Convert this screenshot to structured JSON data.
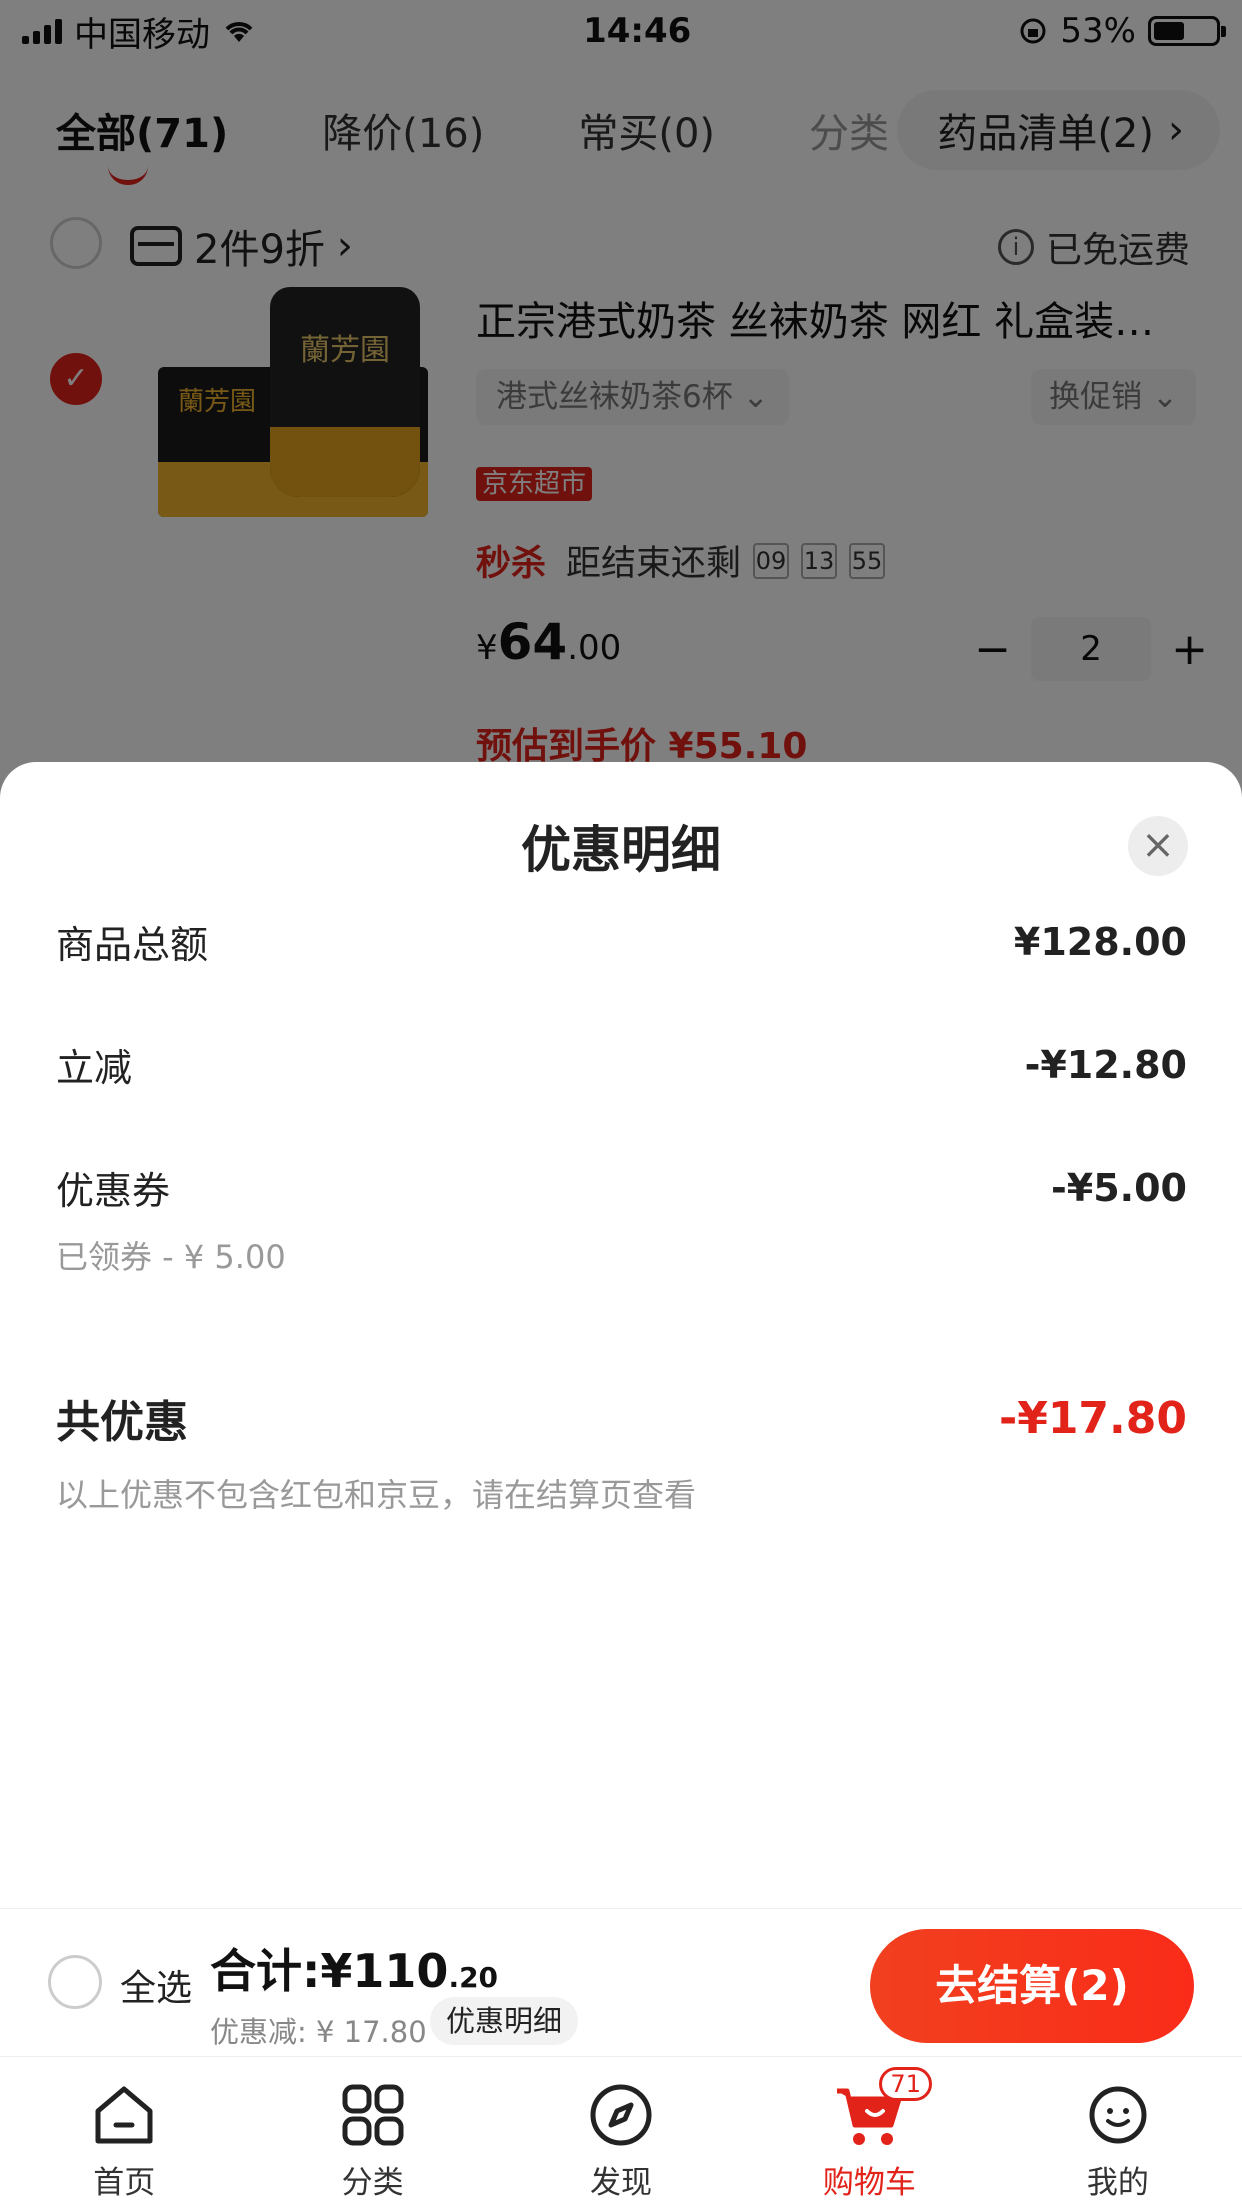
{
  "status_bar": {
    "carrier": "中国移动",
    "time": "14:46",
    "battery": "53%"
  },
  "tabs": {
    "items": [
      {
        "label": "全部(71)"
      },
      {
        "label": "降价(16)"
      },
      {
        "label": "常买(0)"
      },
      {
        "label": "分类"
      }
    ],
    "pill_label": "药品清单(2)",
    "pill_chevron": "›"
  },
  "cart_item": {
    "promo": "2件9折",
    "promo_chevron": "›",
    "shipping": "已免运费",
    "product_title": "正宗港式奶茶 丝袜奶茶 网红 礼盒装…",
    "brand_on_pack": "蘭芳園",
    "spec": "港式丝袜奶茶6杯",
    "switch_promo": "换促销",
    "store_tag": "京东超市",
    "flash_label": "秒杀",
    "flash_text": "距结束还剩",
    "countdown": [
      "09",
      "13",
      "55"
    ],
    "price_symbol": "¥",
    "price_int": "64",
    "price_dec": ".00",
    "qty_minus": "−",
    "quantity": "2",
    "qty_plus": "+",
    "estimated": "预估到手价 ¥55.10"
  },
  "sheet": {
    "title": "优惠明细",
    "close_glyph": "×",
    "rows": [
      {
        "label": "商品总额",
        "amount": "¥128.00"
      },
      {
        "label": "立减",
        "amount": "-¥12.80"
      },
      {
        "label": "优惠券",
        "amount": "-¥5.00",
        "sub": "已领券 - ¥ 5.00"
      }
    ],
    "total": {
      "label": "共优惠",
      "amount": "-¥17.80",
      "note": "以上优惠不包含红包和京豆，请在结算页查看"
    }
  },
  "bottom_bar": {
    "select_all": "全选",
    "total_prefix": "合计:¥110",
    "total_cents": ".20",
    "discount": "优惠减: ¥ 17.80",
    "detail_button": "优惠明细",
    "checkout": "去结算(2)"
  },
  "tabbar": {
    "items": [
      {
        "label": "首页",
        "icon": "home-icon"
      },
      {
        "label": "分类",
        "icon": "category-icon"
      },
      {
        "label": "发现",
        "icon": "compass-icon"
      },
      {
        "label": "购物车",
        "icon": "cart-icon",
        "badge": "71"
      },
      {
        "label": "我的",
        "icon": "profile-icon"
      }
    ]
  },
  "colors": {
    "accent": "#e2231a",
    "checkout_gradient_start": "#f1401f",
    "checkout_gradient_end": "#fa2c19"
  }
}
